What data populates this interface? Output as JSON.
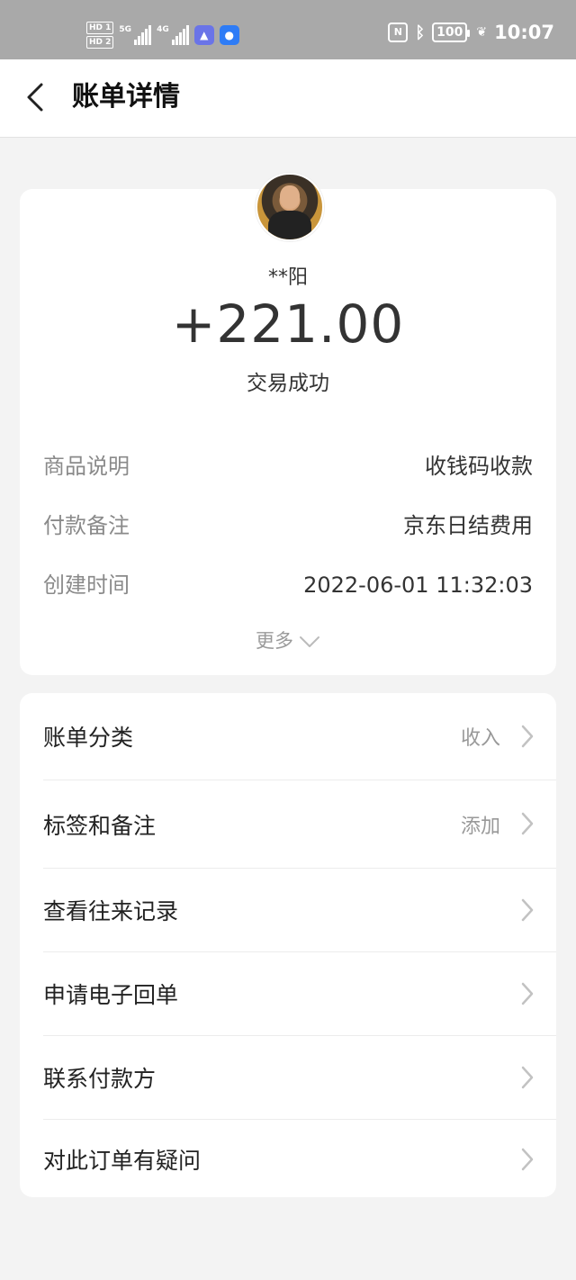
{
  "status_bar": {
    "sim1": "HD 1",
    "sim2": "HD 2",
    "net1": "5G",
    "net2": "4G",
    "nfc_label": "N",
    "bluetooth_icon": "bluetooth-icon",
    "battery": "100",
    "time": "10:07"
  },
  "header": {
    "title": "账单详情",
    "back_icon": "back-chevron-icon"
  },
  "transaction": {
    "payer": "**阳",
    "amount": "+221.00",
    "status": "交易成功",
    "details": [
      {
        "label": "商品说明",
        "value": "收钱码收款"
      },
      {
        "label": "付款备注",
        "value": "京东日结费用"
      },
      {
        "label": "创建时间",
        "value": "2022-06-01 11:32:03"
      }
    ],
    "more_label": "更多"
  },
  "menu": {
    "items": [
      {
        "label": "账单分类",
        "value": "收入"
      },
      {
        "label": "标签和备注",
        "value": "添加"
      },
      {
        "label": "查看往来记录",
        "value": ""
      },
      {
        "label": "申请电子回单",
        "value": ""
      },
      {
        "label": "联系付款方",
        "value": ""
      },
      {
        "label": "对此订单有疑问",
        "value": ""
      }
    ]
  },
  "colors": {
    "status_bar_bg": "#a9a9a9",
    "page_bg": "#f3f3f3",
    "card_bg": "#ffffff",
    "label_gray": "#8a8a8a",
    "text_dark": "#333333"
  }
}
